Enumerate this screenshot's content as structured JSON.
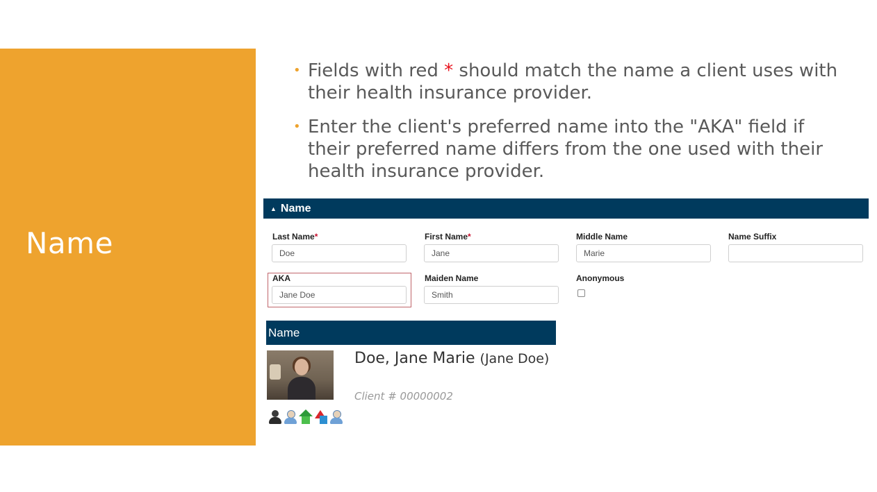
{
  "slide": {
    "title": "Name",
    "bullets": [
      {
        "before_star": "Fields with red ",
        "star": "*",
        "after_star": " should match the name a client uses with their health insurance provider."
      },
      {
        "text": "Enter the client's preferred name into the \"AKA\" field if their preferred name differs from the one used with their health insurance provider."
      }
    ],
    "accent_color": "#eea32e"
  },
  "form": {
    "section_title": "Name",
    "header_color": "#003a5d",
    "fields": {
      "last_name": {
        "label": "Last Name",
        "required_mark": "*",
        "value": "Doe"
      },
      "first_name": {
        "label": "First Name",
        "required_mark": "*",
        "value": "Jane"
      },
      "middle_name": {
        "label": "Middle Name",
        "value": "Marie"
      },
      "name_suffix": {
        "label": "Name Suffix",
        "value": ""
      },
      "aka": {
        "label": "AKA",
        "value": "Jane Doe"
      },
      "maiden_name": {
        "label": "Maiden Name",
        "value": "Smith"
      },
      "anonymous": {
        "label": "Anonymous",
        "checked": false
      }
    }
  },
  "client_card": {
    "header": "Name",
    "display_name": "Doe, Jane Marie",
    "aka_display": "(Jane Doe)",
    "client_number": "Client # 00000002",
    "icons": [
      "person-dark-icon",
      "person-blue-icon",
      "house-icon",
      "shapes-icon",
      "person-blue-icon"
    ]
  }
}
